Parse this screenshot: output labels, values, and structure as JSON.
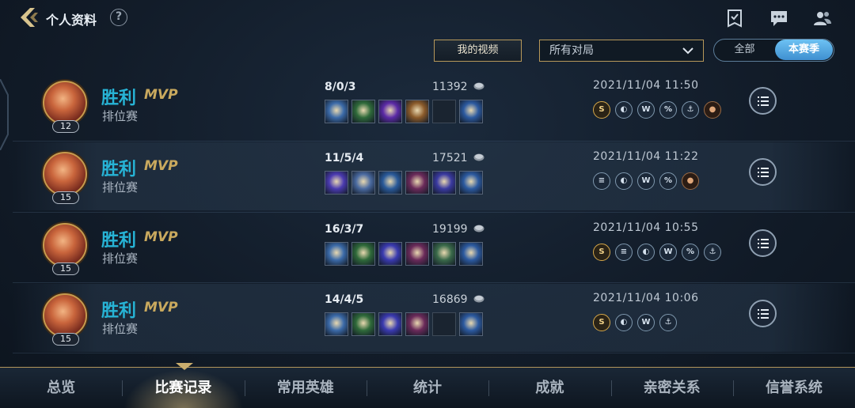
{
  "header": {
    "title": "个人资料",
    "help": "?",
    "icons": [
      "tasks-icon",
      "chat-icon",
      "friends-icon"
    ]
  },
  "filters": {
    "video_button": "我的视频",
    "match_select": "所有对局",
    "segment": {
      "all": "全部",
      "season": "本赛季",
      "selected": "本赛季"
    }
  },
  "matches": [
    {
      "result": "胜利",
      "mvp": "MVP",
      "mode": "排位赛",
      "level": "12",
      "kda": "8/0/3",
      "gold": "11392",
      "time": "2021/11/04 11:50",
      "items": [
        "#3b6aa8",
        "#2f6a3a",
        "#5b2aa6",
        "#8a5a2a",
        "",
        "#2c5aa0"
      ],
      "badges": [
        {
          "glyph": "S",
          "style": "gold"
        },
        {
          "glyph": "◐",
          "style": "blue"
        },
        {
          "glyph": "W",
          "style": "blue"
        },
        {
          "glyph": "%",
          "style": "blue"
        },
        {
          "glyph": "⚓",
          "style": "blue"
        },
        {
          "glyph": "●",
          "style": "copper"
        }
      ]
    },
    {
      "result": "胜利",
      "mvp": "MVP",
      "mode": "排位赛",
      "level": "15",
      "kda": "11/5/4",
      "gold": "17521",
      "time": "2021/11/04 11:22",
      "items": [
        "#4a3ab0",
        "#4a6aa0",
        "#2a5a9a",
        "#6a2a5a",
        "#3a3aa0",
        "#2c5aa0"
      ],
      "badges": [
        {
          "glyph": "≡",
          "style": "blue"
        },
        {
          "glyph": "◐",
          "style": "blue"
        },
        {
          "glyph": "W",
          "style": "blue"
        },
        {
          "glyph": "%",
          "style": "blue"
        },
        {
          "glyph": "●",
          "style": "copper"
        }
      ]
    },
    {
      "result": "胜利",
      "mvp": "MVP",
      "mode": "排位赛",
      "level": "15",
      "kda": "16/3/7",
      "gold": "19199",
      "time": "2021/11/04 10:55",
      "items": [
        "#3b6aa8",
        "#2f6a3a",
        "#3a3ab0",
        "#6a2a5a",
        "#3a6a4a",
        "#2c5aa0"
      ],
      "badges": [
        {
          "glyph": "S",
          "style": "gold"
        },
        {
          "glyph": "≡",
          "style": "blue"
        },
        {
          "glyph": "◐",
          "style": "blue"
        },
        {
          "glyph": "W",
          "style": "blue"
        },
        {
          "glyph": "%",
          "style": "blue"
        },
        {
          "glyph": "⚓",
          "style": "blue"
        }
      ]
    },
    {
      "result": "胜利",
      "mvp": "MVP",
      "mode": "排位赛",
      "level": "15",
      "kda": "14/4/5",
      "gold": "16869",
      "time": "2021/11/04 10:06",
      "items": [
        "#3b6aa8",
        "#2f6a3a",
        "#3a3ab0",
        "#6a2a5a",
        "",
        "#2c5aa0"
      ],
      "badges": [
        {
          "glyph": "S",
          "style": "gold"
        },
        {
          "glyph": "◐",
          "style": "blue"
        },
        {
          "glyph": "W",
          "style": "blue"
        },
        {
          "glyph": "⚓",
          "style": "blue"
        }
      ]
    }
  ],
  "bottom_tabs": [
    {
      "label": "总览",
      "active": false
    },
    {
      "label": "比赛记录",
      "active": true
    },
    {
      "label": "常用英雄",
      "active": false
    },
    {
      "label": "统计",
      "active": false
    },
    {
      "label": "成就",
      "active": false
    },
    {
      "label": "亲密关系",
      "active": false
    },
    {
      "label": "信誉系统",
      "active": false
    }
  ],
  "colors": {
    "victory": "#27b4d6",
    "mvp": "#c9a95e",
    "accent_gold": "#b7985a",
    "segment_active": "#4fa6e0"
  }
}
